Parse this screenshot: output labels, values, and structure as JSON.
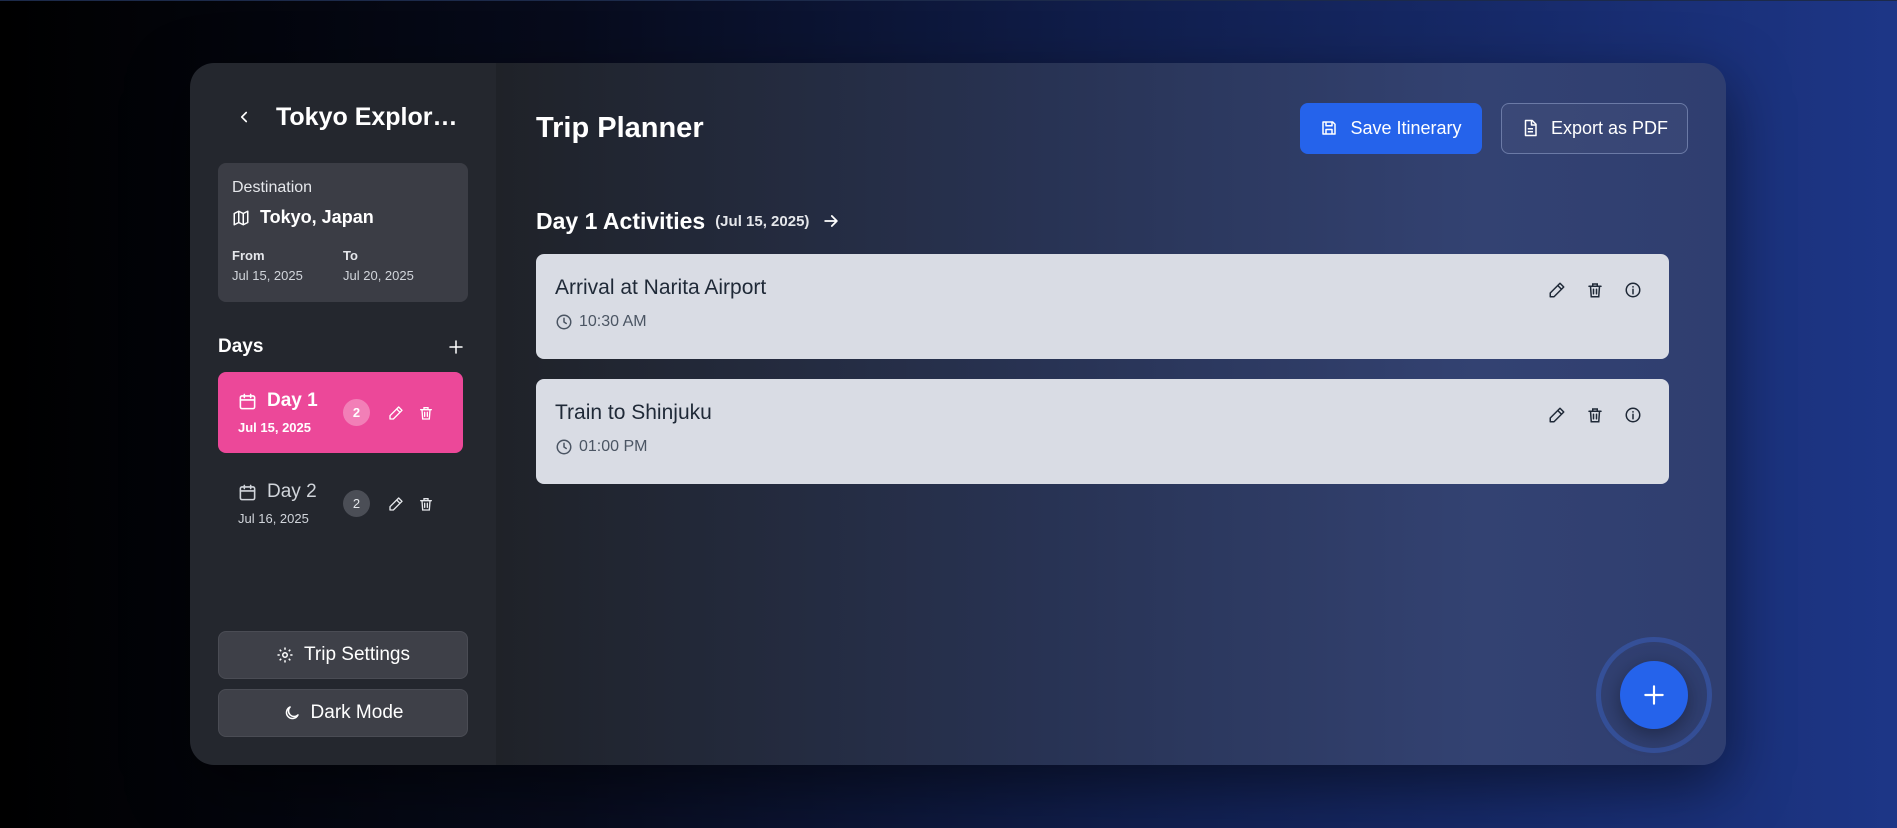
{
  "sidebar": {
    "trip_title": "Tokyo Explorat...",
    "destination": {
      "label": "Destination",
      "name": "Tokyo, Japan",
      "from_label": "From",
      "from_date": "Jul 15, 2025",
      "to_label": "To",
      "to_date": "Jul 20, 2025"
    },
    "days_title": "Days",
    "days": [
      {
        "name": "Day 1",
        "date": "Jul 15, 2025",
        "count": "2",
        "active": true
      },
      {
        "name": "Day 2",
        "date": "Jul 16, 2025",
        "count": "2",
        "active": false
      }
    ],
    "settings_label": "Trip Settings",
    "dark_mode_label": "Dark Mode"
  },
  "main": {
    "title": "Trip Planner",
    "save_label": "Save Itinerary",
    "export_label": "Export as PDF",
    "section_title": "Day 1 Activities",
    "section_date": "(Jul 15, 2025)",
    "activities": [
      {
        "name": "Arrival at Narita Airport",
        "time": "10:30 AM"
      },
      {
        "name": "Train to Shinjuku",
        "time": "01:00 PM"
      }
    ]
  },
  "colors": {
    "accent": "#2563eb",
    "active_day": "#ec4899",
    "sidebar_bg": "#24272e",
    "card_bg": "#d9dce4"
  },
  "icons": {
    "back": "chevron-left-icon",
    "map": "map-icon",
    "add": "plus-icon",
    "calendar": "calendar-icon",
    "edit": "pencil-icon",
    "delete": "trash-icon",
    "info": "info-icon",
    "clock": "clock-icon",
    "save": "save-icon",
    "file": "file-icon",
    "settings": "gear-icon",
    "moon": "moon-icon",
    "arrow": "arrow-right-icon"
  }
}
